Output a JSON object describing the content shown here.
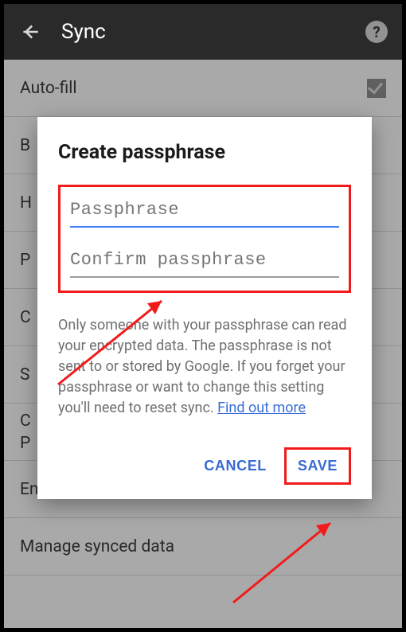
{
  "topbar": {
    "title": "Sync"
  },
  "list": {
    "items": [
      "Auto-fill",
      "B",
      "H",
      "P",
      "C",
      "S",
      "C",
      "P",
      "Encryption",
      "Manage synced data"
    ]
  },
  "dialog": {
    "title": "Create passphrase",
    "passphrase_placeholder": "Passphrase",
    "confirm_placeholder": "Confirm passphrase",
    "description_pre": "Only someone with your passphrase can read your encrypted data. The passphrase is not sent to or stored by Google. If you forget your passphrase or want to change this setting you'll need to reset sync. ",
    "find_out_more": "Find out more",
    "cancel": "CANCEL",
    "save": "SAVE"
  }
}
